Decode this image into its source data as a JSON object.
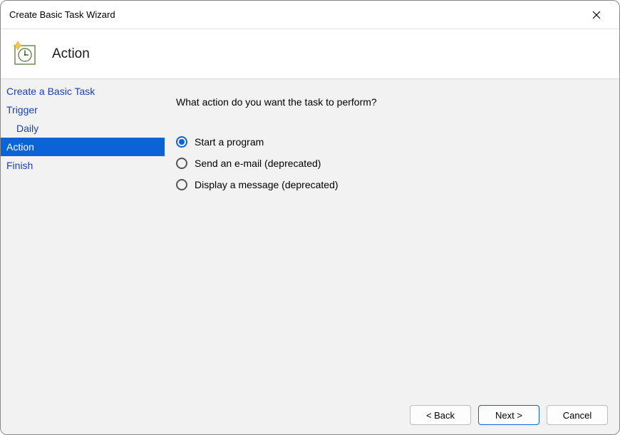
{
  "window": {
    "title": "Create Basic Task Wizard"
  },
  "header": {
    "title": "Action"
  },
  "sidebar": {
    "items": [
      {
        "label": "Create a Basic Task",
        "indent": false,
        "active": false
      },
      {
        "label": "Trigger",
        "indent": false,
        "active": false
      },
      {
        "label": "Daily",
        "indent": true,
        "active": false
      },
      {
        "label": "Action",
        "indent": false,
        "active": true
      },
      {
        "label": "Finish",
        "indent": false,
        "active": false
      }
    ]
  },
  "content": {
    "prompt": "What action do you want the task to perform?",
    "options": [
      {
        "label": "Start a program",
        "checked": true
      },
      {
        "label": "Send an e-mail (deprecated)",
        "checked": false
      },
      {
        "label": "Display a message (deprecated)",
        "checked": false
      }
    ]
  },
  "footer": {
    "back": "< Back",
    "next": "Next >",
    "cancel": "Cancel"
  }
}
